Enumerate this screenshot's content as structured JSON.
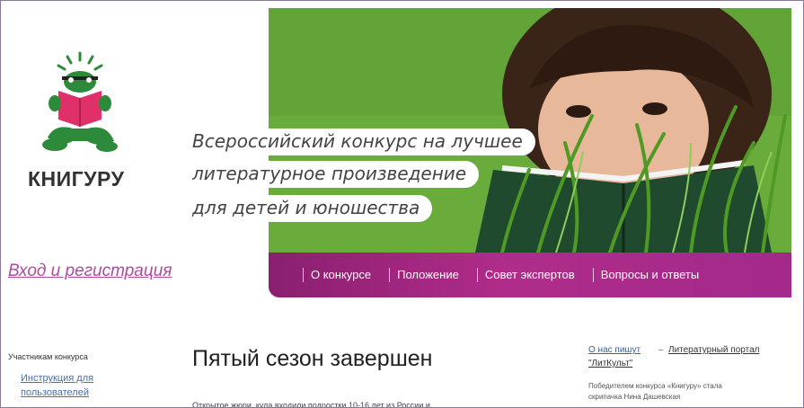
{
  "logo": {
    "word": "КНИГУРУ"
  },
  "hero": {
    "tagline_line1": "Всероссийский конкурс на лучшее",
    "tagline_line2": "литературное произведение",
    "tagline_line3": "для детей и юношества"
  },
  "login_link": "Вход и регистрация",
  "nav": {
    "items": [
      "О конкурсе",
      "Положение",
      "Совет экспертов",
      "Вопросы и ответы"
    ]
  },
  "sidebar": {
    "title": "Участникам конкурса",
    "link_line1": "Инструкция для",
    "link_line2": "пользователей"
  },
  "main": {
    "title": "Пятый сезон завершен",
    "text": "Открытое жюри, куда входили подростки 10-16 лет из России и"
  },
  "right": {
    "link1": "О нас пишут",
    "sep": "–",
    "link2": "Литературный портал",
    "link3": "\"ЛитКульт\"",
    "text1": "Победителем конкурса «Книгуру» стала",
    "text2": "скрипачка Нина Дашевская"
  },
  "colors": {
    "nav_gradient_start": "#8a1f6f",
    "nav_gradient_end": "#b02c8a",
    "login_link": "#b04aa0",
    "logo_green": "#3a9a4a",
    "logo_pink": "#e0306a"
  }
}
